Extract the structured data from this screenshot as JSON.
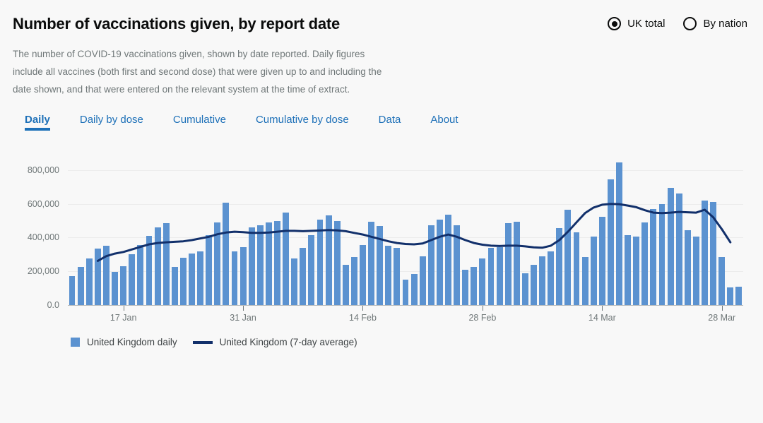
{
  "header": {
    "title": "Number of vaccinations given, by report date",
    "description": "The number of COVID-19 vaccinations given, shown by date reported. Daily figures include all vaccines (both first and second dose) that were given up to and including the date shown, and that were entered on the relevant system at the time of extract.",
    "scope_options": [
      {
        "label": "UK total",
        "selected": true
      },
      {
        "label": "By nation",
        "selected": false
      }
    ]
  },
  "tabs": [
    {
      "label": "Daily",
      "active": true
    },
    {
      "label": "Daily by dose",
      "active": false
    },
    {
      "label": "Cumulative",
      "active": false
    },
    {
      "label": "Cumulative by dose",
      "active": false
    },
    {
      "label": "Data",
      "active": false
    },
    {
      "label": "About",
      "active": false
    }
  ],
  "colors": {
    "accent": "#1d70b8",
    "bar": "#5b92d0",
    "average_line": "#12306b",
    "background": "#f8f8f8",
    "text_muted": "#6f7778",
    "gridline": "#ececec"
  },
  "chart_data": {
    "type": "bar",
    "title": "Number of vaccinations given, by report date",
    "xlabel": "",
    "ylabel": "",
    "ylim": [
      0,
      900000
    ],
    "grid": true,
    "ytick_labels": [
      "0.0",
      "200,000",
      "400,000",
      "600,000",
      "800,000"
    ],
    "ytick_values": [
      0,
      200000,
      400000,
      600000,
      800000
    ],
    "xtick_labels": [
      "17 Jan",
      "31 Jan",
      "14 Feb",
      "28 Feb",
      "14 Mar",
      "28 Mar"
    ],
    "xtick_indices": [
      6,
      20,
      34,
      48,
      62,
      76
    ],
    "legend_position": "bottom-left",
    "legend": [
      {
        "name": "United Kingdom daily",
        "type": "bar",
        "color": "#5b92d0"
      },
      {
        "name": "United Kingdom (7-day average)",
        "type": "line",
        "color": "#12306b"
      }
    ],
    "series": [
      {
        "name": "United Kingdom daily",
        "type": "bar",
        "values": [
          170000,
          225000,
          275000,
          335000,
          350000,
          195000,
          230000,
          300000,
          355000,
          410000,
          460000,
          485000,
          225000,
          280000,
          305000,
          320000,
          415000,
          490000,
          605000,
          320000,
          345000,
          460000,
          475000,
          490000,
          500000,
          550000,
          275000,
          340000,
          415000,
          505000,
          530000,
          500000,
          240000,
          285000,
          355000,
          495000,
          470000,
          350000,
          340000,
          150000,
          185000,
          290000,
          475000,
          505000,
          535000,
          475000,
          210000,
          225000,
          275000,
          340000,
          345000,
          485000,
          495000,
          190000,
          240000,
          290000,
          320000,
          455000,
          565000,
          430000,
          285000,
          405000,
          525000,
          745000,
          845000,
          415000,
          405000,
          490000,
          570000,
          600000,
          695000,
          660000,
          445000,
          405000,
          620000,
          610000,
          285000,
          105000,
          110000
        ]
      },
      {
        "name": "United Kingdom (7-day average)",
        "type": "line",
        "values": [
          null,
          null,
          null,
          262000,
          290000,
          305000,
          315000,
          330000,
          345000,
          360000,
          368000,
          372000,
          375000,
          378000,
          385000,
          395000,
          405000,
          420000,
          430000,
          435000,
          432000,
          428000,
          428000,
          430000,
          435000,
          440000,
          440000,
          438000,
          440000,
          442000,
          445000,
          443000,
          438000,
          428000,
          418000,
          405000,
          392000,
          378000,
          368000,
          362000,
          360000,
          365000,
          385000,
          405000,
          418000,
          405000,
          385000,
          368000,
          358000,
          352000,
          350000,
          352000,
          352000,
          348000,
          342000,
          340000,
          352000,
          385000,
          435000,
          490000,
          545000,
          578000,
          595000,
          600000,
          598000,
          590000,
          580000,
          562000,
          548000,
          545000,
          548000,
          552000,
          550000,
          548000,
          565000,
          520000,
          450000,
          372000,
          null
        ]
      }
    ]
  }
}
